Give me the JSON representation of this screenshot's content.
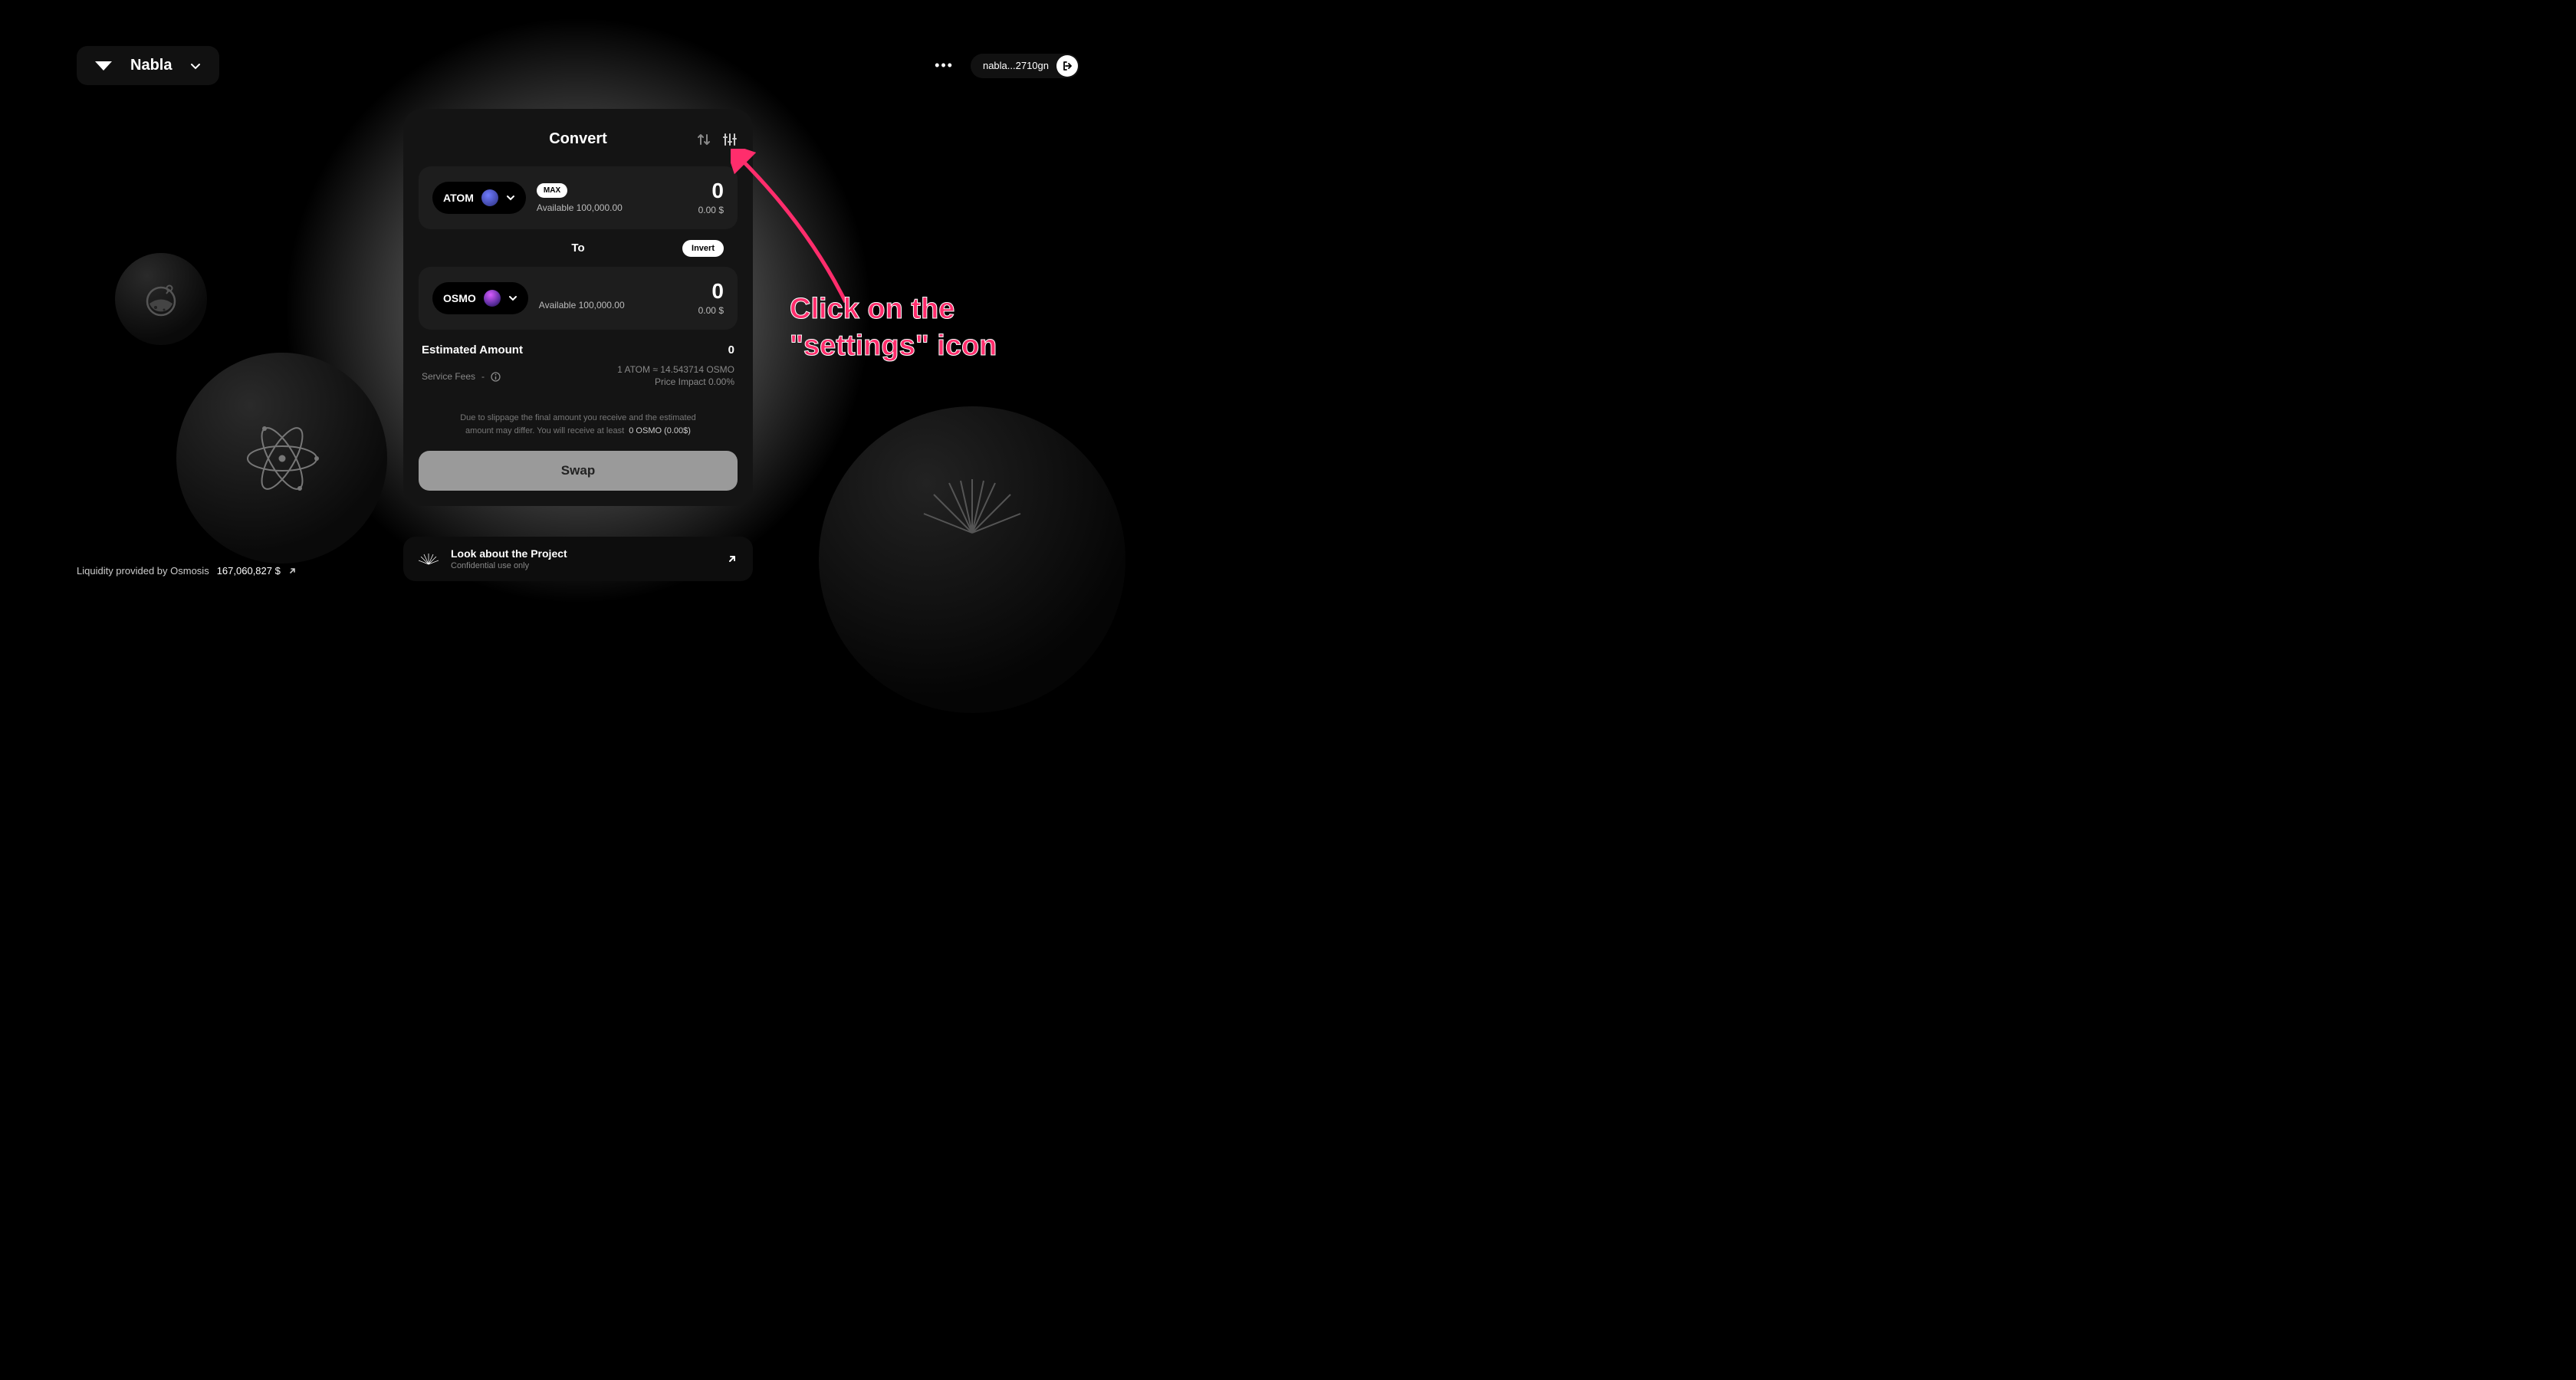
{
  "header": {
    "app_name": "Nabla",
    "wallet": "nabla...2710gn"
  },
  "card": {
    "title": "Convert",
    "from": {
      "symbol": "ATOM",
      "max_label": "MAX",
      "available_label": "Available 100,000.00",
      "amount": "0",
      "usd": "0.00 $"
    },
    "to_label": "To",
    "invert_label": "Invert",
    "to": {
      "symbol": "OSMO",
      "available_label": "Available 100,000.00",
      "amount": "0",
      "usd": "0.00 $"
    },
    "estimated_label": "Estimated Amount",
    "estimated_value": "0",
    "fees_label": "Service Fees",
    "fees_value": "-",
    "rate": "1 ATOM ≈ 14.543714 OSMO",
    "price_impact": "Price Impact 0.00%",
    "slippage_note_1": "Due to slippage the final amount you receive and the estimated",
    "slippage_note_2": "amount may differ. You will receive at least",
    "min_out": "0 OSMO (0.00$)",
    "swap_label": "Swap"
  },
  "project": {
    "line1": "Look about the Project",
    "line2": "Confidential use only"
  },
  "liquidity": {
    "label": "Liquidity provided by Osmosis",
    "value": "167,060,827 $"
  },
  "annotation": {
    "line1": "Click on the",
    "line2": "\"settings\" icon"
  }
}
